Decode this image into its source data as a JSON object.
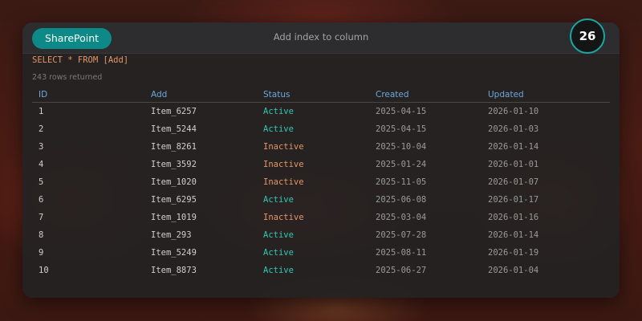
{
  "app": {
    "name": "SharePoint",
    "window_title": "Add index to column",
    "badge_count": "26"
  },
  "query": {
    "text": "SELECT * FROM [Add]",
    "rows_returned": "243 rows returned"
  },
  "table": {
    "columns": [
      "ID",
      "Add",
      "Status",
      "Created",
      "Updated"
    ],
    "rows": [
      [
        "1",
        "Item_6257",
        "Active",
        "2025-04-15",
        "2026-01-10"
      ],
      [
        "2",
        "Item_5244",
        "Active",
        "2025-04-15",
        "2026-01-03"
      ],
      [
        "3",
        "Item_8261",
        "Inactive",
        "2025-10-04",
        "2026-01-14"
      ],
      [
        "4",
        "Item_3592",
        "Inactive",
        "2025-01-24",
        "2026-01-01"
      ],
      [
        "5",
        "Item_1020",
        "Inactive",
        "2025-11-05",
        "2026-01-07"
      ],
      [
        "6",
        "Item_6295",
        "Active",
        "2025-06-08",
        "2026-01-17"
      ],
      [
        "7",
        "Item_1019",
        "Inactive",
        "2025-03-04",
        "2026-01-16"
      ],
      [
        "8",
        "Item_293",
        "Active",
        "2025-07-28",
        "2026-01-14"
      ],
      [
        "9",
        "Item_5249",
        "Active",
        "2025-08-11",
        "2026-01-19"
      ],
      [
        "10",
        "Item_8873",
        "Active",
        "2025-06-27",
        "2026-01-04"
      ]
    ]
  },
  "colors": {
    "accent": "#0d8a88",
    "header_text": "#6aa8dc",
    "status_active": "#35c6b2",
    "status_inactive": "#e2966a"
  }
}
